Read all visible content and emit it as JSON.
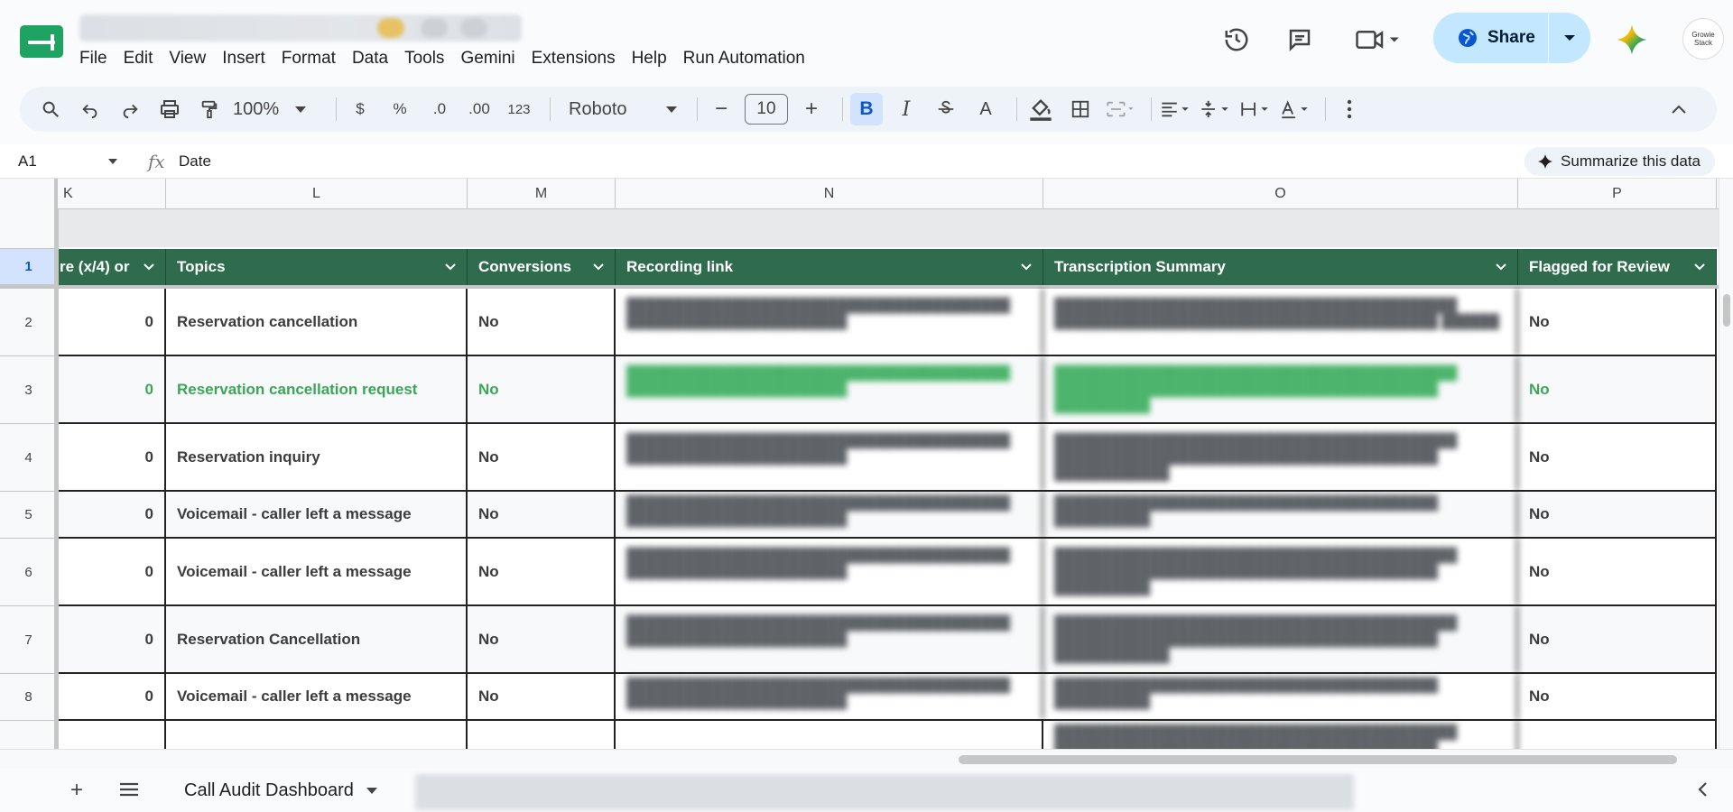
{
  "menus": [
    "File",
    "Edit",
    "View",
    "Insert",
    "Format",
    "Data",
    "Tools",
    "Gemini",
    "Extensions",
    "Help",
    "Run Automation"
  ],
  "share": {
    "label": "Share"
  },
  "avatar": {
    "line1": "Growie",
    "line2": "Stack"
  },
  "toolbar": {
    "zoom": "100%",
    "currency": "$",
    "percent": "%",
    "dec_decrease": ".0",
    "dec_increase": ".00",
    "number_format": "123",
    "font": "Roboto",
    "font_size": "10",
    "bold": "B",
    "italic": "I",
    "text_color": "A"
  },
  "formula_bar": {
    "cell_ref": "A1",
    "fx": "fx",
    "value": "Date"
  },
  "summarize": {
    "label": "Summarize this data"
  },
  "columns": [
    "K",
    "L",
    "M",
    "N",
    "O",
    "P"
  ],
  "headers": [
    "re (x/4) or",
    "Topics",
    "Conversions",
    "Recording link",
    "Transcription Summary",
    "Flagged for Review"
  ],
  "rows": [
    {
      "num": "2",
      "score": "0",
      "topic": "Reservation cancellation",
      "conversions": "No",
      "flagged": "No"
    },
    {
      "num": "3",
      "score": "0",
      "topic": "Reservation cancellation request",
      "conversions": "No",
      "flagged": "No"
    },
    {
      "num": "4",
      "score": "0",
      "topic": "Reservation inquiry",
      "conversions": "No",
      "flagged": "No"
    },
    {
      "num": "5",
      "score": "0",
      "topic": "Voicemail - caller left a message",
      "conversions": "No",
      "flagged": "No"
    },
    {
      "num": "6",
      "score": "0",
      "topic": "Voicemail - caller left a message",
      "conversions": "No",
      "flagged": "No"
    },
    {
      "num": "7",
      "score": "0",
      "topic": "Reservation Cancellation",
      "conversions": "No",
      "flagged": "No"
    },
    {
      "num": "8",
      "score": "0",
      "topic": "Voicemail - caller left a message",
      "conversions": "No",
      "flagged": "No"
    }
  ],
  "header_row_num": "1",
  "sheet_tabs": {
    "active": "Call Audit Dashboard"
  },
  "colors": {
    "header_green": "#2f6b4d",
    "accent_green": "#3aa757",
    "share_bg": "#c2e7ff",
    "selection": "#d3e3fd"
  }
}
